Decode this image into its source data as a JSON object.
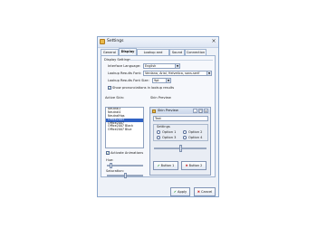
{
  "window": {
    "title": "Settings",
    "close_glyph": "×"
  },
  "tabs": [
    {
      "label": "General",
      "active": false
    },
    {
      "label": "Display",
      "active": true
    },
    {
      "label": "Lookup and Capture",
      "active": false
    },
    {
      "label": "Sound",
      "active": false
    },
    {
      "label": "Connection",
      "active": false
    }
  ],
  "display_settings": {
    "group_title": "Display Settings",
    "interface_language_label": "Interface Language:",
    "interface_language_value": "English",
    "results_font_label": "Lookup Results Font:",
    "results_font_value": "Verdana, Arial, Helvetica, sans-serif",
    "font_size_label": "Lookup Results Font Size:",
    "font_size_value": "9pt",
    "show_pron_label": "Show pronunciations in lookup results",
    "show_pron_checked": true
  },
  "skins": {
    "active_skin_label": "Active Skin:",
    "items": [
      "Neutral3",
      "Neutral4",
      "NeutralHqs",
      "Office2003",
      "Office2007",
      "Office2007 Black",
      "Office2007 Blue"
    ],
    "selected_index": 3,
    "activate_animations_label": "Activate Animations",
    "activate_animations_checked": true,
    "hue_label": "Hue:",
    "hue_level": 0.08,
    "saturation_label": "Saturation:",
    "saturation_level": 0.5
  },
  "preview": {
    "section_label": "Skin Preview",
    "window_title": "Skin Preview",
    "text_value": "Text",
    "settings_label": "Settings",
    "options": [
      "Option 1",
      "Option 2",
      "Option 3",
      "Option 4"
    ],
    "slider_level": 0.5,
    "button1_label": "Button 1",
    "button2_label": "Button 2"
  },
  "footer": {
    "apply_label": "Apply",
    "cancel_label": "Cancel"
  },
  "colors": {
    "selection": "#3163c5",
    "check_green": "#1a8f2a",
    "cancel_red": "#c62222"
  }
}
